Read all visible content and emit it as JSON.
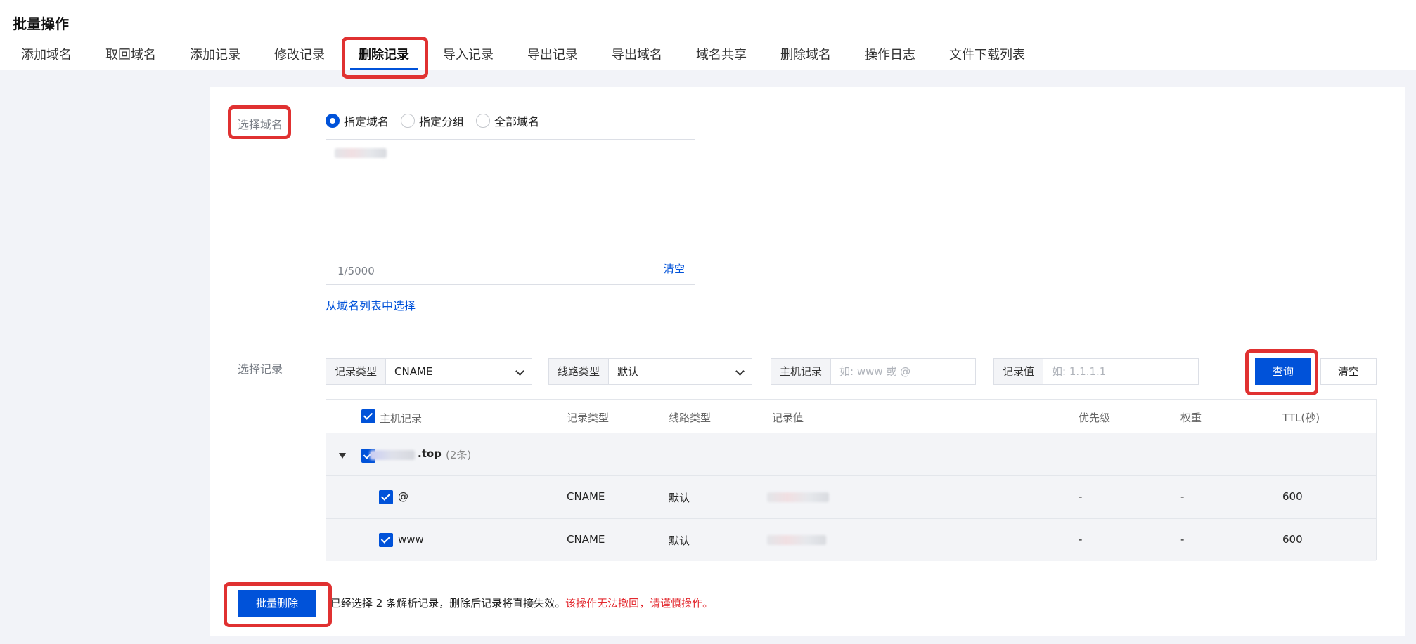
{
  "page": {
    "title": "批量操作"
  },
  "tabs": [
    "添加域名",
    "取回域名",
    "添加记录",
    "修改记录",
    "删除记录",
    "导入记录",
    "导出记录",
    "导出域名",
    "域名共享",
    "删除域名",
    "操作日志",
    "文件下载列表"
  ],
  "active_tab": "删除记录",
  "domain_section": {
    "label": "选择域名",
    "radios": [
      "指定域名",
      "指定分组",
      "全部域名"
    ],
    "selected_radio": "指定域名",
    "counter": "1/5000",
    "clear_label": "清空",
    "pick_from_list": "从域名列表中选择"
  },
  "record_section": {
    "label": "选择记录",
    "record_type": {
      "label": "记录类型",
      "value": "CNAME"
    },
    "line_type": {
      "label": "线路类型",
      "value": "默认"
    },
    "host": {
      "label": "主机记录",
      "placeholder": "如: www 或 @"
    },
    "value": {
      "label": "记录值",
      "placeholder": "如: 1.1.1.1"
    },
    "query_button": "查询",
    "clear_button": "清空"
  },
  "table": {
    "columns": [
      "主机记录",
      "记录类型",
      "线路类型",
      "记录值",
      "优先级",
      "权重",
      "TTL(秒)"
    ],
    "group": {
      "name_suffix": ".top",
      "count": "(2条)"
    },
    "rows": [
      {
        "host": "@",
        "type": "CNAME",
        "line": "默认",
        "priority": "-",
        "weight": "-",
        "ttl": "600"
      },
      {
        "host": "www",
        "type": "CNAME",
        "line": "默认",
        "priority": "-",
        "weight": "-",
        "ttl": "600"
      }
    ]
  },
  "footer": {
    "batch_delete": "批量删除",
    "notice": "已经选择 2 条解析记录，删除后记录将直接失效。",
    "warning": "该操作无法撤回，请谨慎操作。"
  },
  "colors": {
    "primary": "#0052d9",
    "highlight": "#e03131",
    "warning": "#e3282e"
  }
}
